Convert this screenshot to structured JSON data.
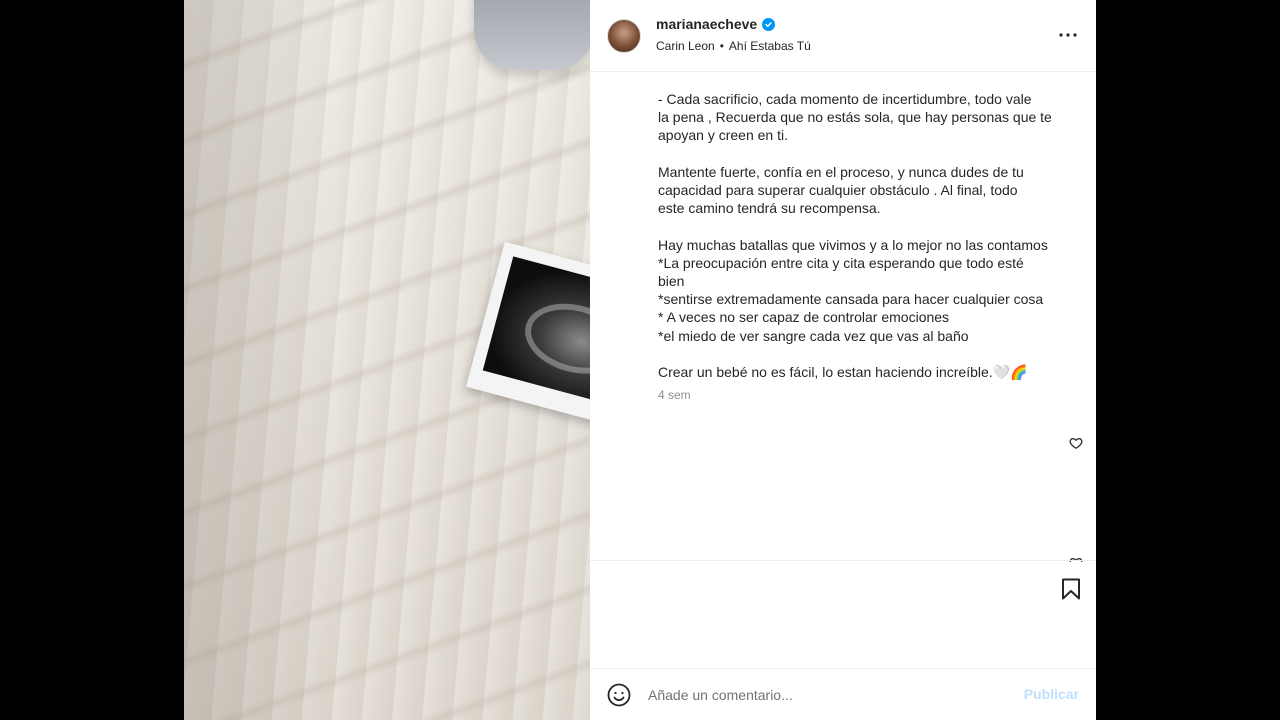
{
  "post": {
    "username": "marianaecheve",
    "verified": true,
    "audio": {
      "artist": "Carin Leon",
      "separator": "•",
      "track": "Ahí Estabas Tú"
    },
    "caption_paragraphs": [
      [
        "- Cada sacrificio, cada momento de incertidumbre, todo vale",
        "la pena , Recuerda que no estás sola, que hay personas que te",
        "apoyan y creen en ti."
      ],
      [
        "Mantente fuerte, confía en el proceso, y nunca dudes de tu",
        "capacidad para superar cualquier obstáculo . Al final, todo",
        "este camino tendrá su recompensa."
      ],
      [
        "Hay muchas batallas que vivimos y a lo mejor no las contamos",
        "*La preocupación entre cita y cita esperando que todo esté",
        "bien",
        "*sentirse extremadamente cansada para hacer cualquier cosa",
        "* A veces no ser capaz de controlar emociones",
        "*el miedo de ver sangre cada vez que vas al baño"
      ],
      [
        "Crear un bebé no es fácil, lo estan haciendo increíble.🤍🌈"
      ]
    ],
    "timestamp": "4 sem"
  },
  "comment_bar": {
    "placeholder": "Añade un comentario...",
    "publish_label": "Publicar"
  },
  "icons": {
    "more": "more-options-icon",
    "like": "heart-icon",
    "bookmark": "bookmark-icon",
    "emoji": "emoji-icon",
    "mute": "speaker-muted-icon"
  },
  "colors": {
    "verified": "#0095f6",
    "publish_disabled": "#c0dffd",
    "text": "#262626",
    "secondary": "#8e8e8e"
  }
}
